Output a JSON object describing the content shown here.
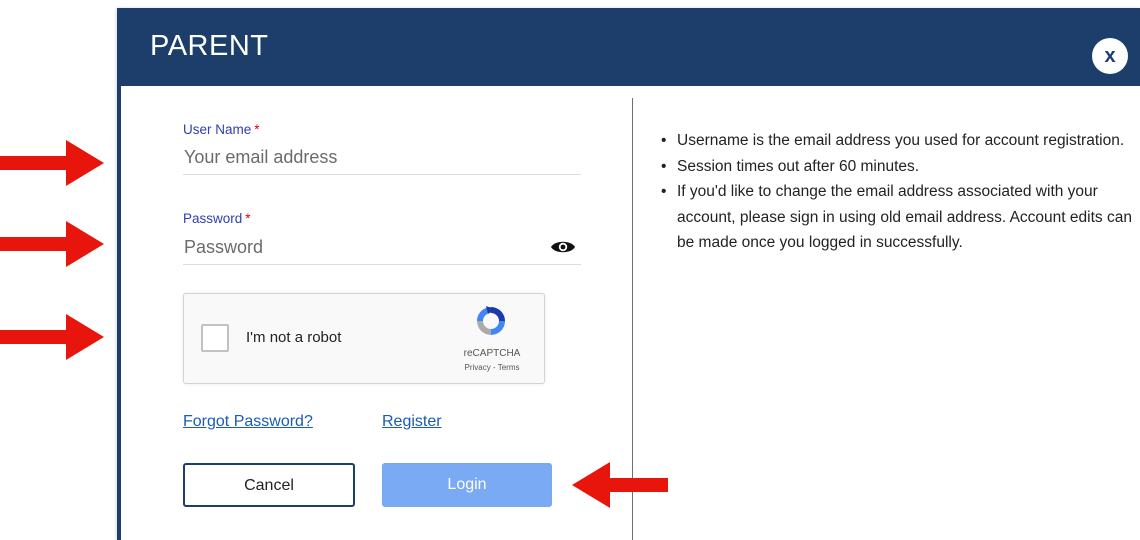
{
  "dialog": {
    "title": "PARENT",
    "close_label": "x"
  },
  "form": {
    "username": {
      "label": "User Name",
      "required_mark": "*",
      "placeholder": "Your email address",
      "value": ""
    },
    "password": {
      "label": "Password",
      "required_mark": "*",
      "placeholder": "Password",
      "value": ""
    },
    "captcha": {
      "checkbox_label": "I'm not a robot",
      "brand": "reCAPTCHA",
      "links": "Privacy - Terms",
      "checked": false
    },
    "forgot_password_link": "Forgot Password?",
    "register_link": "Register",
    "cancel_label": "Cancel",
    "login_label": "Login"
  },
  "info": {
    "items": [
      "Username is the email address you used for account registration.",
      "Session times out after 60 minutes.",
      "If you'd like to change the email address associated with your account, please sign in using old email address. Account edits can be made once you logged in successfully."
    ]
  },
  "colors": {
    "header_bg": "#1d3e6a",
    "label_blue": "#2f3fb0",
    "required_red": "#d0021b",
    "link_blue": "#1a5bb5",
    "login_bg": "#79aaf3",
    "annotation_arrow": "#e8150c"
  }
}
